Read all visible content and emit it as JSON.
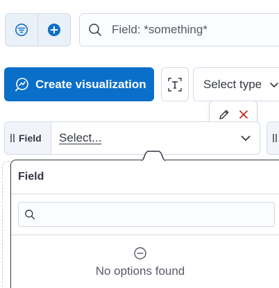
{
  "query_bar": {
    "placeholder": "Field: *something*"
  },
  "toolbar": {
    "create_label": "Create visualization",
    "type_select_label": "Select type"
  },
  "control": {
    "field_label": "Field",
    "value_placeholder": "Select..."
  },
  "popover": {
    "title": "Field",
    "search_value": "",
    "empty_message": "No options found"
  },
  "colors": {
    "primary": "#0a6fc9",
    "danger": "#bd271e",
    "border": "#d3dae6",
    "text": "#343741"
  },
  "icons": [
    "filter-icon",
    "add-icon",
    "search-icon",
    "visualize-icon",
    "text-icon",
    "chevron-down-icon",
    "pencil-icon",
    "close-icon",
    "grip-icon",
    "minus-circle-icon"
  ]
}
